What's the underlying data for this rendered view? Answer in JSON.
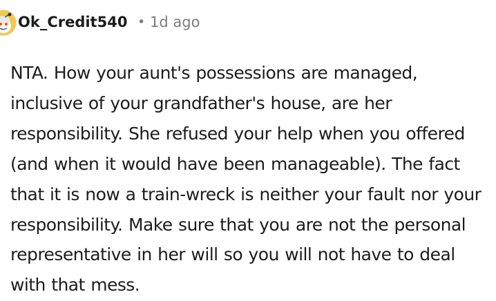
{
  "comment": {
    "author": "Ok_Credit540",
    "separator": "•",
    "timestamp": "1d ago",
    "avatar_icon": "snoo-avatar-icon",
    "body": "NTA. How your aunt's possessions are managed, inclusive of your grandfather's house, are her responsibility. She refused your help when you offered (and when it would have been manageable). The fact that it is now a train-wreck is neither your fault nor your responsibility. Make sure that you are not the personal representative in her will so you will not have to deal with that mess."
  },
  "colors": {
    "text": "#1c1c1c",
    "meta": "#7c7c7c",
    "avatar_bg": "#f2c94c",
    "background": "#ffffff"
  }
}
